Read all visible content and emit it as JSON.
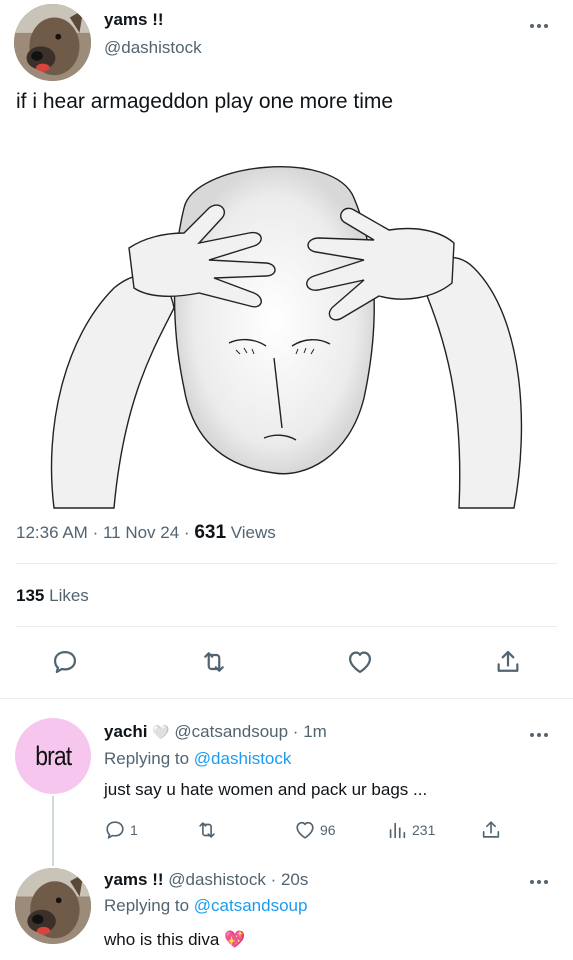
{
  "tweet": {
    "author_name": "yams !!",
    "author_handle": "@dashistock",
    "text": "if i hear armageddon play one more time",
    "time": "12:36 AM",
    "date": "11 Nov 24",
    "views_count": "631",
    "views_label": "Views",
    "likes_count": "135",
    "likes_label": "Likes",
    "avatar_icon": "dog-photo-avatar",
    "image_icon": "stressed-man-holding-head-meme"
  },
  "replies": [
    {
      "author_name": "yachi",
      "author_emoji": "🤍",
      "author_handle": "@catsandsoup",
      "time": "1m",
      "replying_label": "Replying to",
      "replying_to": "@dashistock",
      "text": "just say u hate women and pack ur bags ...",
      "avatar_text": "brat",
      "avatar_color": "#f7c6ef",
      "reply_count": "1",
      "like_count": "96",
      "views_count": "231"
    },
    {
      "author_name": "yams !!",
      "author_handle": "@dashistock",
      "time": "20s",
      "replying_label": "Replying to",
      "replying_to": "@catsandsoup",
      "text": "who is this diva",
      "emoji": "💖"
    }
  ],
  "colors": {
    "text": "#0f1419",
    "secondary": "#536471",
    "link": "#1d9bf0",
    "divider": "#e6ecf0"
  }
}
